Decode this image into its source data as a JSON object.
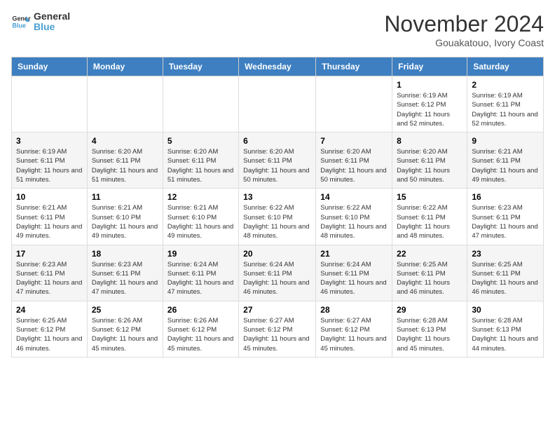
{
  "logo": {
    "line1": "General",
    "line2": "Blue"
  },
  "title": "November 2024",
  "location": "Gouakatouo, Ivory Coast",
  "days_of_week": [
    "Sunday",
    "Monday",
    "Tuesday",
    "Wednesday",
    "Thursday",
    "Friday",
    "Saturday"
  ],
  "weeks": [
    [
      {
        "day": "",
        "info": ""
      },
      {
        "day": "",
        "info": ""
      },
      {
        "day": "",
        "info": ""
      },
      {
        "day": "",
        "info": ""
      },
      {
        "day": "",
        "info": ""
      },
      {
        "day": "1",
        "info": "Sunrise: 6:19 AM\nSunset: 6:12 PM\nDaylight: 11 hours and 52 minutes."
      },
      {
        "day": "2",
        "info": "Sunrise: 6:19 AM\nSunset: 6:11 PM\nDaylight: 11 hours and 52 minutes."
      }
    ],
    [
      {
        "day": "3",
        "info": "Sunrise: 6:19 AM\nSunset: 6:11 PM\nDaylight: 11 hours and 51 minutes."
      },
      {
        "day": "4",
        "info": "Sunrise: 6:20 AM\nSunset: 6:11 PM\nDaylight: 11 hours and 51 minutes."
      },
      {
        "day": "5",
        "info": "Sunrise: 6:20 AM\nSunset: 6:11 PM\nDaylight: 11 hours and 51 minutes."
      },
      {
        "day": "6",
        "info": "Sunrise: 6:20 AM\nSunset: 6:11 PM\nDaylight: 11 hours and 50 minutes."
      },
      {
        "day": "7",
        "info": "Sunrise: 6:20 AM\nSunset: 6:11 PM\nDaylight: 11 hours and 50 minutes."
      },
      {
        "day": "8",
        "info": "Sunrise: 6:20 AM\nSunset: 6:11 PM\nDaylight: 11 hours and 50 minutes."
      },
      {
        "day": "9",
        "info": "Sunrise: 6:21 AM\nSunset: 6:11 PM\nDaylight: 11 hours and 49 minutes."
      }
    ],
    [
      {
        "day": "10",
        "info": "Sunrise: 6:21 AM\nSunset: 6:11 PM\nDaylight: 11 hours and 49 minutes."
      },
      {
        "day": "11",
        "info": "Sunrise: 6:21 AM\nSunset: 6:10 PM\nDaylight: 11 hours and 49 minutes."
      },
      {
        "day": "12",
        "info": "Sunrise: 6:21 AM\nSunset: 6:10 PM\nDaylight: 11 hours and 49 minutes."
      },
      {
        "day": "13",
        "info": "Sunrise: 6:22 AM\nSunset: 6:10 PM\nDaylight: 11 hours and 48 minutes."
      },
      {
        "day": "14",
        "info": "Sunrise: 6:22 AM\nSunset: 6:10 PM\nDaylight: 11 hours and 48 minutes."
      },
      {
        "day": "15",
        "info": "Sunrise: 6:22 AM\nSunset: 6:11 PM\nDaylight: 11 hours and 48 minutes."
      },
      {
        "day": "16",
        "info": "Sunrise: 6:23 AM\nSunset: 6:11 PM\nDaylight: 11 hours and 47 minutes."
      }
    ],
    [
      {
        "day": "17",
        "info": "Sunrise: 6:23 AM\nSunset: 6:11 PM\nDaylight: 11 hours and 47 minutes."
      },
      {
        "day": "18",
        "info": "Sunrise: 6:23 AM\nSunset: 6:11 PM\nDaylight: 11 hours and 47 minutes."
      },
      {
        "day": "19",
        "info": "Sunrise: 6:24 AM\nSunset: 6:11 PM\nDaylight: 11 hours and 47 minutes."
      },
      {
        "day": "20",
        "info": "Sunrise: 6:24 AM\nSunset: 6:11 PM\nDaylight: 11 hours and 46 minutes."
      },
      {
        "day": "21",
        "info": "Sunrise: 6:24 AM\nSunset: 6:11 PM\nDaylight: 11 hours and 46 minutes."
      },
      {
        "day": "22",
        "info": "Sunrise: 6:25 AM\nSunset: 6:11 PM\nDaylight: 11 hours and 46 minutes."
      },
      {
        "day": "23",
        "info": "Sunrise: 6:25 AM\nSunset: 6:11 PM\nDaylight: 11 hours and 46 minutes."
      }
    ],
    [
      {
        "day": "24",
        "info": "Sunrise: 6:25 AM\nSunset: 6:12 PM\nDaylight: 11 hours and 46 minutes."
      },
      {
        "day": "25",
        "info": "Sunrise: 6:26 AM\nSunset: 6:12 PM\nDaylight: 11 hours and 45 minutes."
      },
      {
        "day": "26",
        "info": "Sunrise: 6:26 AM\nSunset: 6:12 PM\nDaylight: 11 hours and 45 minutes."
      },
      {
        "day": "27",
        "info": "Sunrise: 6:27 AM\nSunset: 6:12 PM\nDaylight: 11 hours and 45 minutes."
      },
      {
        "day": "28",
        "info": "Sunrise: 6:27 AM\nSunset: 6:12 PM\nDaylight: 11 hours and 45 minutes."
      },
      {
        "day": "29",
        "info": "Sunrise: 6:28 AM\nSunset: 6:13 PM\nDaylight: 11 hours and 45 minutes."
      },
      {
        "day": "30",
        "info": "Sunrise: 6:28 AM\nSunset: 6:13 PM\nDaylight: 11 hours and 44 minutes."
      }
    ]
  ]
}
